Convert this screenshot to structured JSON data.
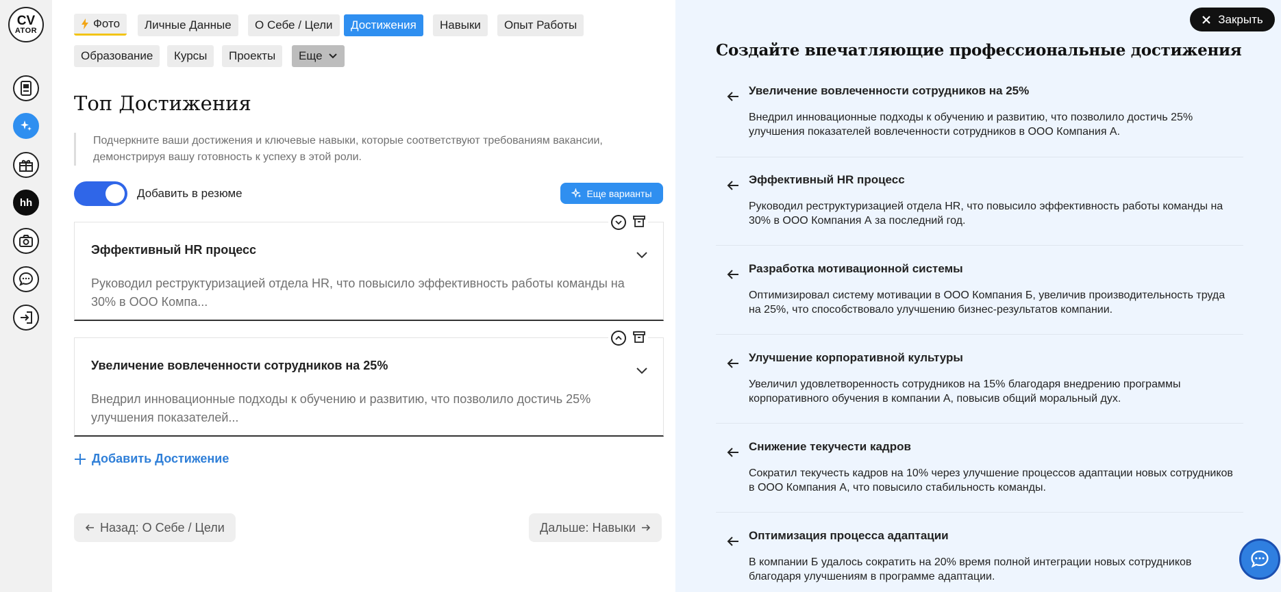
{
  "logo": {
    "line1": "CV",
    "line2": "ATOR"
  },
  "sidebar": {
    "items": [
      {
        "icon": "document-icon"
      },
      {
        "icon": "sparkle-icon",
        "active": true
      },
      {
        "icon": "gift-icon"
      },
      {
        "icon": "hh-icon",
        "label": "hh"
      },
      {
        "icon": "camera-icon"
      },
      {
        "icon": "chat-icon"
      },
      {
        "icon": "login-icon"
      }
    ]
  },
  "tabs": [
    {
      "label": "Фото",
      "icon": "lightning-icon"
    },
    {
      "label": "Личные Данные"
    },
    {
      "label": "О Себе / Цели"
    },
    {
      "label": "Достижения",
      "active": true
    },
    {
      "label": "Навыки"
    },
    {
      "label": "Опыт Работы"
    },
    {
      "label": "Образование"
    },
    {
      "label": "Курсы"
    },
    {
      "label": "Проекты"
    },
    {
      "label": "Еще",
      "icon": "chevron-down-icon"
    }
  ],
  "main": {
    "title": "Топ Достижения",
    "hint": "Подчеркните ваши достижения и ключевые навыки, которые соответствуют требованиям вакансии, демонстрируя вашу готовность к успеху в этой роли.",
    "toggle_label": "Добавить в резюме",
    "toggle_on": true,
    "more_variants": "Еще варианты",
    "cards": [
      {
        "title": "Эффективный HR процесс",
        "desc": "Руководил реструктуризацией отдела HR, что повысило эффективность работы команды на 30% в ООО Компа..."
      },
      {
        "title": "Увеличение вовлеченности сотрудников на 25%",
        "desc": "Внедрил инновационные подходы к обучению и развитию, что позволило достичь 25% улучшения показателей..."
      }
    ],
    "add_label": "Добавить Достижение",
    "back_label": "Назад: О Себе / Цели",
    "next_label": "Дальше: Навыки"
  },
  "panel": {
    "close_label": "Закрыть",
    "title": "Создайте впечатляющие профессиональные достижения",
    "suggestions": [
      {
        "title": "Увеличение вовлеченности сотрудников на 25%",
        "desc": "Внедрил инновационные подходы к обучению и развитию, что позволило достичь 25% улучшения показателей вовлеченности сотрудников в ООО Компания А."
      },
      {
        "title": "Эффективный HR процесс",
        "desc": "Руководил реструктуризацией отдела HR, что повысило эффективность работы команды на 30% в ООО Компания А за последний год."
      },
      {
        "title": "Разработка мотивационной системы",
        "desc": "Оптимизировал систему мотивации в ООО Компания Б, увеличив производительность труда на 25%, что способствовало улучшению бизнес-результатов компании."
      },
      {
        "title": "Улучшение корпоративной культуры",
        "desc": "Увеличил удовлетворенность сотрудников на 15% благодаря внедрению программы корпоративного обучения в компании А, повысив общий моральный дух."
      },
      {
        "title": "Снижение текучести кадров",
        "desc": "Сократил текучесть кадров на 10% через улучшение процессов адаптации новых сотрудников в ООО Компания А, что повысило стабильность команды."
      },
      {
        "title": "Оптимизация процесса адаптации",
        "desc": "В компании Б удалось сократить на 20% время полной интеграции новых сотрудников благодаря улучшениям в программе адаптации."
      }
    ]
  },
  "colors": {
    "accent": "#2f8ff0",
    "toggle": "#2f66e8",
    "panel_bg": "#eef5fe",
    "link": "#2f7fd8"
  }
}
